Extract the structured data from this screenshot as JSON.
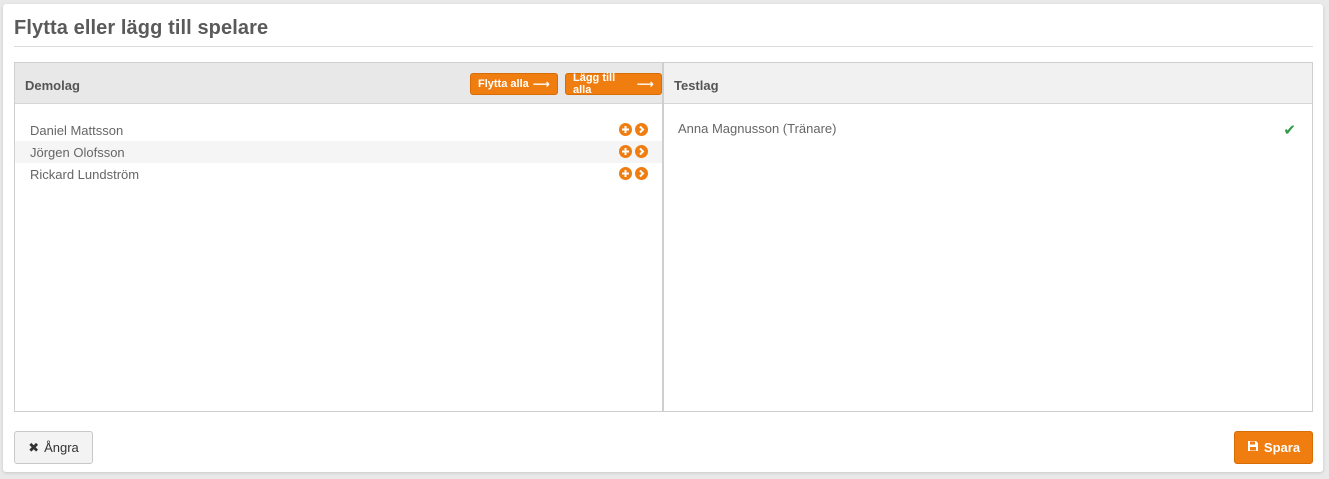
{
  "modal": {
    "title": "Flytta eller lägg till spelare"
  },
  "left_panel": {
    "title": "Demolag",
    "move_all_label": "Flytta alla",
    "add_all_label": "Lägg till alla",
    "players": [
      {
        "name": "Daniel Mattsson"
      },
      {
        "name": "Jörgen Olofsson"
      },
      {
        "name": "Rickard Lundström"
      }
    ]
  },
  "right_panel": {
    "title": "Testlag",
    "players": [
      {
        "name": "Anna Magnusson (Tränare)",
        "status": "check-icon"
      }
    ]
  },
  "footer": {
    "undo_label": "Ångra",
    "save_label": "Spara"
  },
  "colors": {
    "accent": "#f07d10",
    "check": "#2e9a46"
  }
}
